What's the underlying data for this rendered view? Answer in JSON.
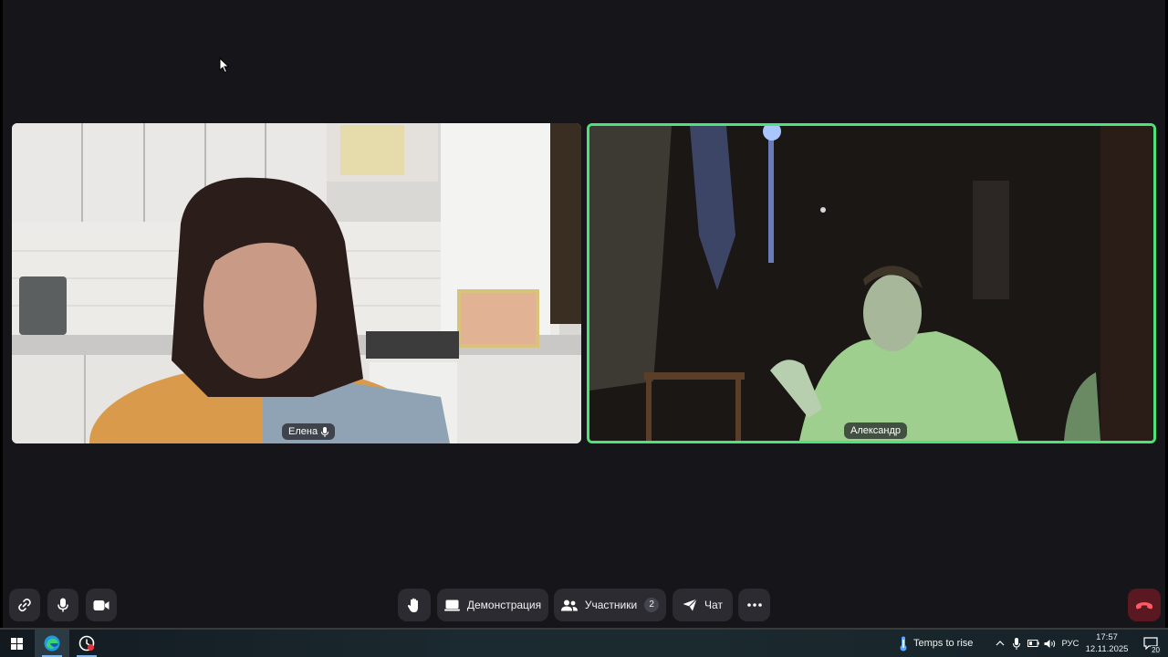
{
  "participants": [
    {
      "name": "Елена",
      "mic_icon": "microphone-icon"
    },
    {
      "name": "Александр",
      "speaking": true
    }
  ],
  "toolbar": {
    "left": [
      {
        "icon": "link-icon"
      },
      {
        "icon": "microphone-icon"
      },
      {
        "icon": "camera-icon"
      }
    ],
    "raise_hand_icon": "hand-icon",
    "screen_share_label": "Демонстрация",
    "participants_label": "Участники",
    "participants_count": "2",
    "chat_label": "Чат",
    "more_icon": "more-icon",
    "end_call_icon": "phone-hangup-icon"
  },
  "taskbar": {
    "weather_text": "Temps to rise",
    "language": "РУС",
    "time": "17:57",
    "date": "12.11.2025",
    "notifications_count": "20"
  },
  "colors": {
    "background": "#16161a",
    "button": "#2b2b31",
    "speaking_border": "#4be37a",
    "end_call": "#5a1820"
  }
}
